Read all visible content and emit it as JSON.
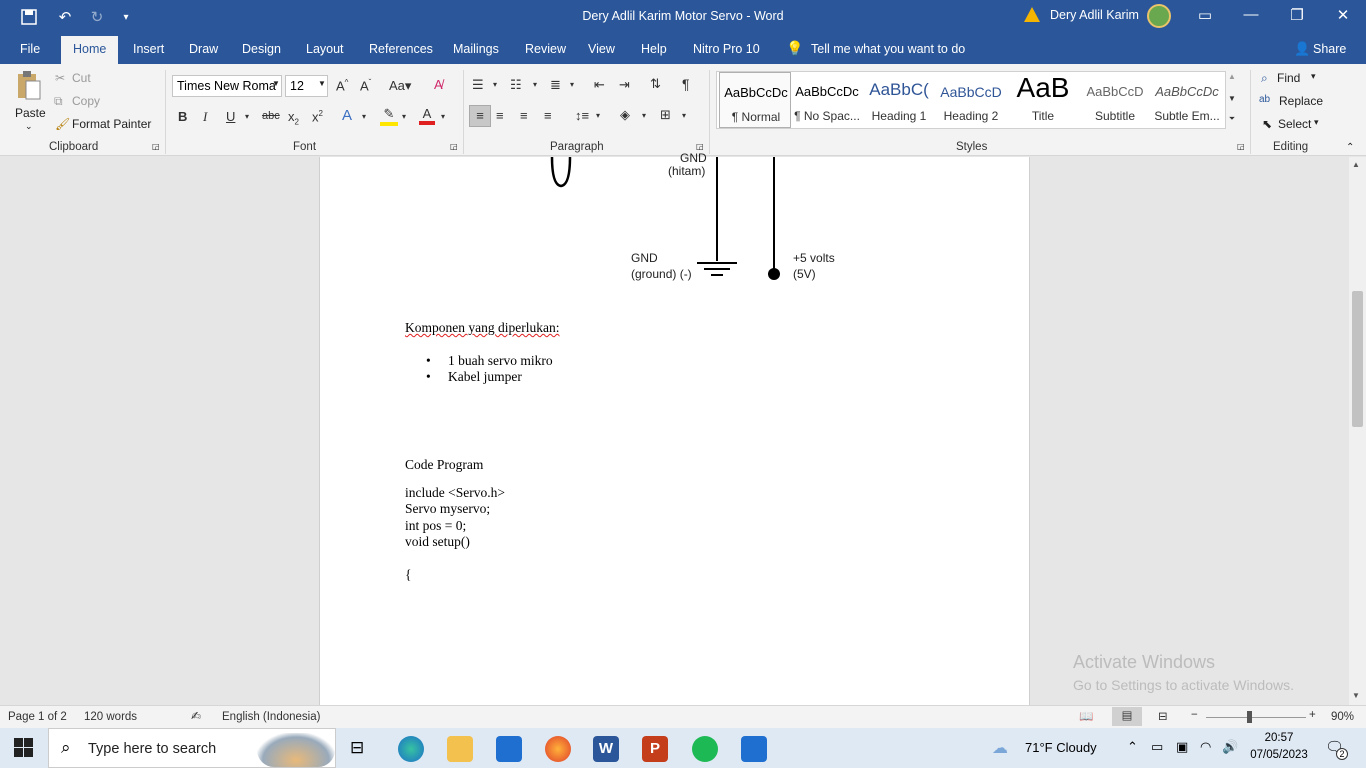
{
  "titlebar": {
    "doc_title": "Dery Adlil Karim Motor Servo  -  Word",
    "user": "Dery Adlil Karim"
  },
  "tabs": [
    "File",
    "Home",
    "Insert",
    "Draw",
    "Design",
    "Layout",
    "References",
    "Mailings",
    "Review",
    "View",
    "Help",
    "Nitro Pro 10"
  ],
  "tell_me": "Tell me what you want to do",
  "share": "Share",
  "clipboard": {
    "paste": "Paste",
    "cut": "Cut",
    "copy": "Copy",
    "format_painter": "Format Painter",
    "label": "Clipboard"
  },
  "font": {
    "name": "Times New Roma",
    "size": "12",
    "label": "Font"
  },
  "paragraph": {
    "label": "Paragraph"
  },
  "styles": {
    "items": [
      {
        "preview": "AaBbCcDc",
        "name": "¶ Normal"
      },
      {
        "preview": "AaBbCcDc",
        "name": "¶ No Spac..."
      },
      {
        "preview": "AaBbC(",
        "name": "Heading 1"
      },
      {
        "preview": "AaBbCcD",
        "name": "Heading 2"
      },
      {
        "preview": "AaB",
        "name": "Title"
      },
      {
        "preview": "AaBbCcD",
        "name": "Subtitle"
      },
      {
        "preview": "AaBbCcDc",
        "name": "Subtle Em..."
      }
    ],
    "label": "Styles"
  },
  "editing": {
    "find": "Find",
    "replace": "Replace",
    "select": "Select",
    "label": "Editing"
  },
  "diagram": {
    "gnd_top_1": "GND",
    "gnd_top_2": "(hitam)",
    "gnd_1": "GND",
    "gnd_2": "(ground) (-)",
    "vcc_1": "+5 volts",
    "vcc_2": "(5V)"
  },
  "document": {
    "komponen_heading": "Komponen yang diperlukan:",
    "komponen_items": [
      "1 buah servo mikro",
      "Kabel jumper"
    ],
    "code_heading": "Code Program",
    "code_lines": [
      "include <Servo.h>",
      "Servo myservo;",
      "int pos = 0;",
      "void setup()",
      "{"
    ]
  },
  "watermark": {
    "line1": "Activate Windows",
    "line2": "Go to Settings to activate Windows."
  },
  "status": {
    "page": "Page 1 of 2",
    "words": "120 words",
    "language": "English (Indonesia)",
    "zoom": "90%"
  },
  "taskbar": {
    "search_placeholder": "Type here to search",
    "weather": "71°F  Cloudy",
    "time": "20:57",
    "date": "07/05/2023",
    "notif_count": "2"
  }
}
